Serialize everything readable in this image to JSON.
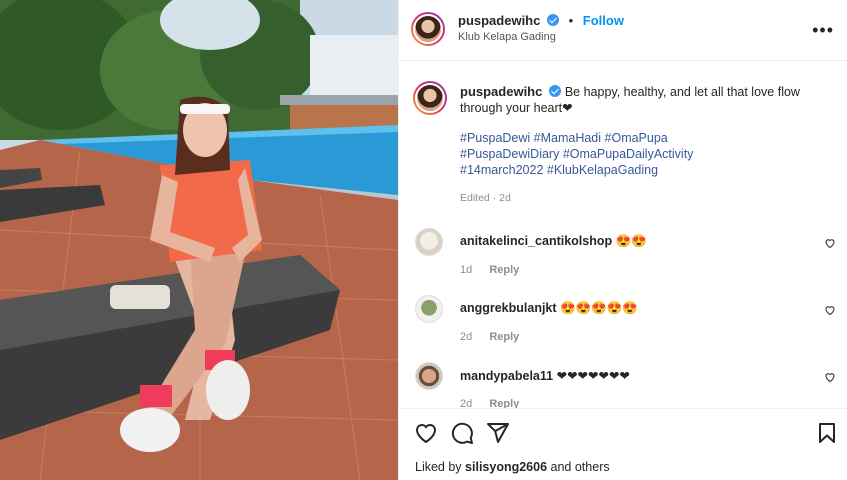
{
  "post": {
    "username": "puspadewihc",
    "follow_label": "Follow",
    "separator": "•",
    "location": "Klub Kelapa Gading",
    "more_label": "•••"
  },
  "caption": {
    "username": "puspadewihc",
    "text": "Be happy, healthy, and let all that love flow through your heart❤",
    "hashtags": [
      "#PuspaDewi #MamaHadi #OmaPupa",
      "#PuspaDewiDiary #OmaPupaDailyActivity",
      "#14march2022 #KlubKelapaGading"
    ],
    "edited": "Edited · 2d"
  },
  "comments": [
    {
      "username": "anitakelinci_cantikolshop",
      "text": "😍😍",
      "time": "1d",
      "reply": "Reply"
    },
    {
      "username": "anggrekbulanjkt",
      "text": "😍😍😍😍😍",
      "time": "2d",
      "reply": "Reply"
    },
    {
      "username": "mandypabela11",
      "text": "❤❤❤❤❤❤❤",
      "time": "2d",
      "reply": "Reply"
    }
  ],
  "likes": {
    "prefix": "Liked by",
    "user": "silisyong2606",
    "suffix": "and others"
  },
  "colors": {
    "link": "#0095f6",
    "hashtag": "#385898",
    "verified": "#3897f0"
  }
}
